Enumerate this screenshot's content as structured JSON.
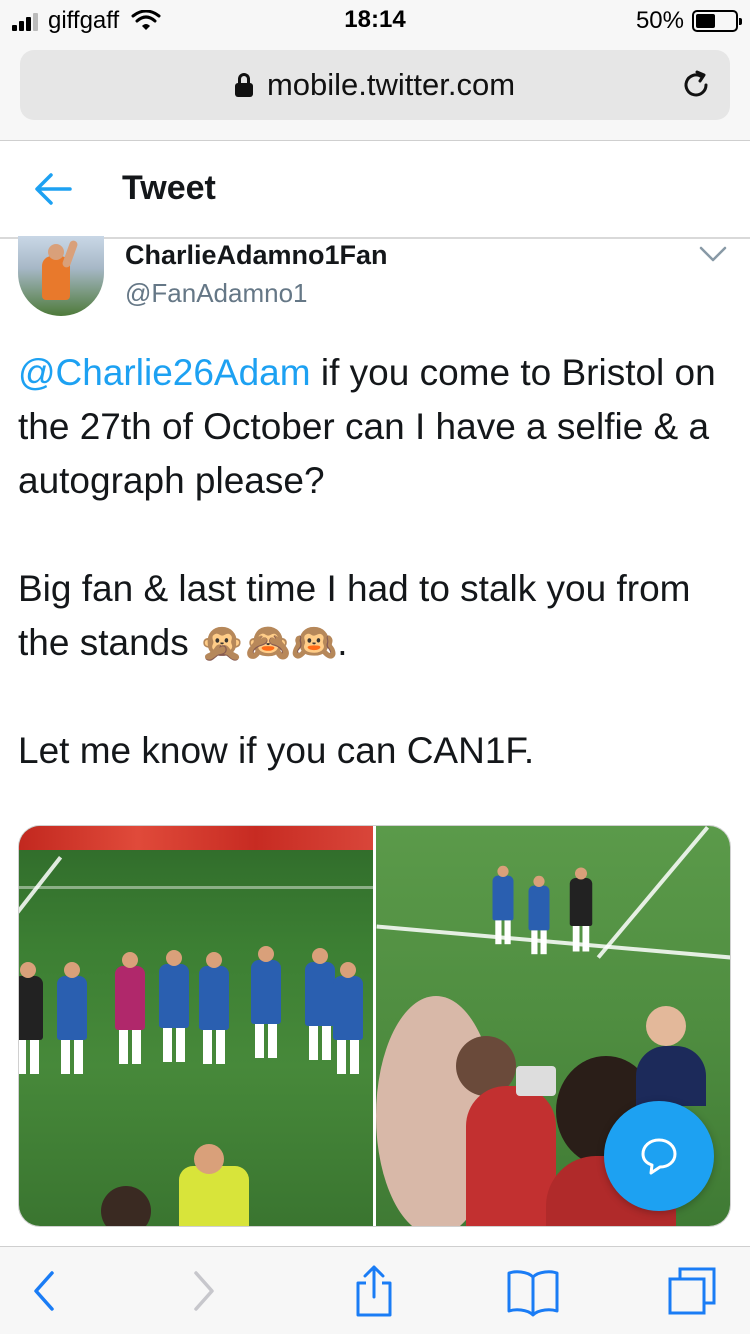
{
  "status_bar": {
    "carrier": "giffgaff",
    "time": "18:14",
    "battery_percent": "50%",
    "battery_level": 0.5
  },
  "browser": {
    "url": "mobile.twitter.com"
  },
  "header": {
    "title": "Tweet"
  },
  "tweet": {
    "author_name": "CharlieAdamno1Fan",
    "author_handle": "@FanAdamno1",
    "mention": "@Charlie26Adam",
    "line1_rest": " if you come to Bristol on the 27th of October can I have a selfie & a autograph please?",
    "line2": "Big fan & last time I had to stalk you from the stands 🙊🙈🙉.",
    "line3": "Let me know if you can CAN1F.",
    "photos": [
      "football-players-lineup",
      "football-crowd-pitch"
    ]
  },
  "colors": {
    "accent": "#1da1f2",
    "text": "#14171a",
    "secondary": "#657786"
  },
  "icons": {
    "back": "back-arrow-icon",
    "caret": "chevron-down-icon",
    "compose": "speech-bubble-icon",
    "lock": "lock-icon",
    "reload": "reload-icon"
  }
}
